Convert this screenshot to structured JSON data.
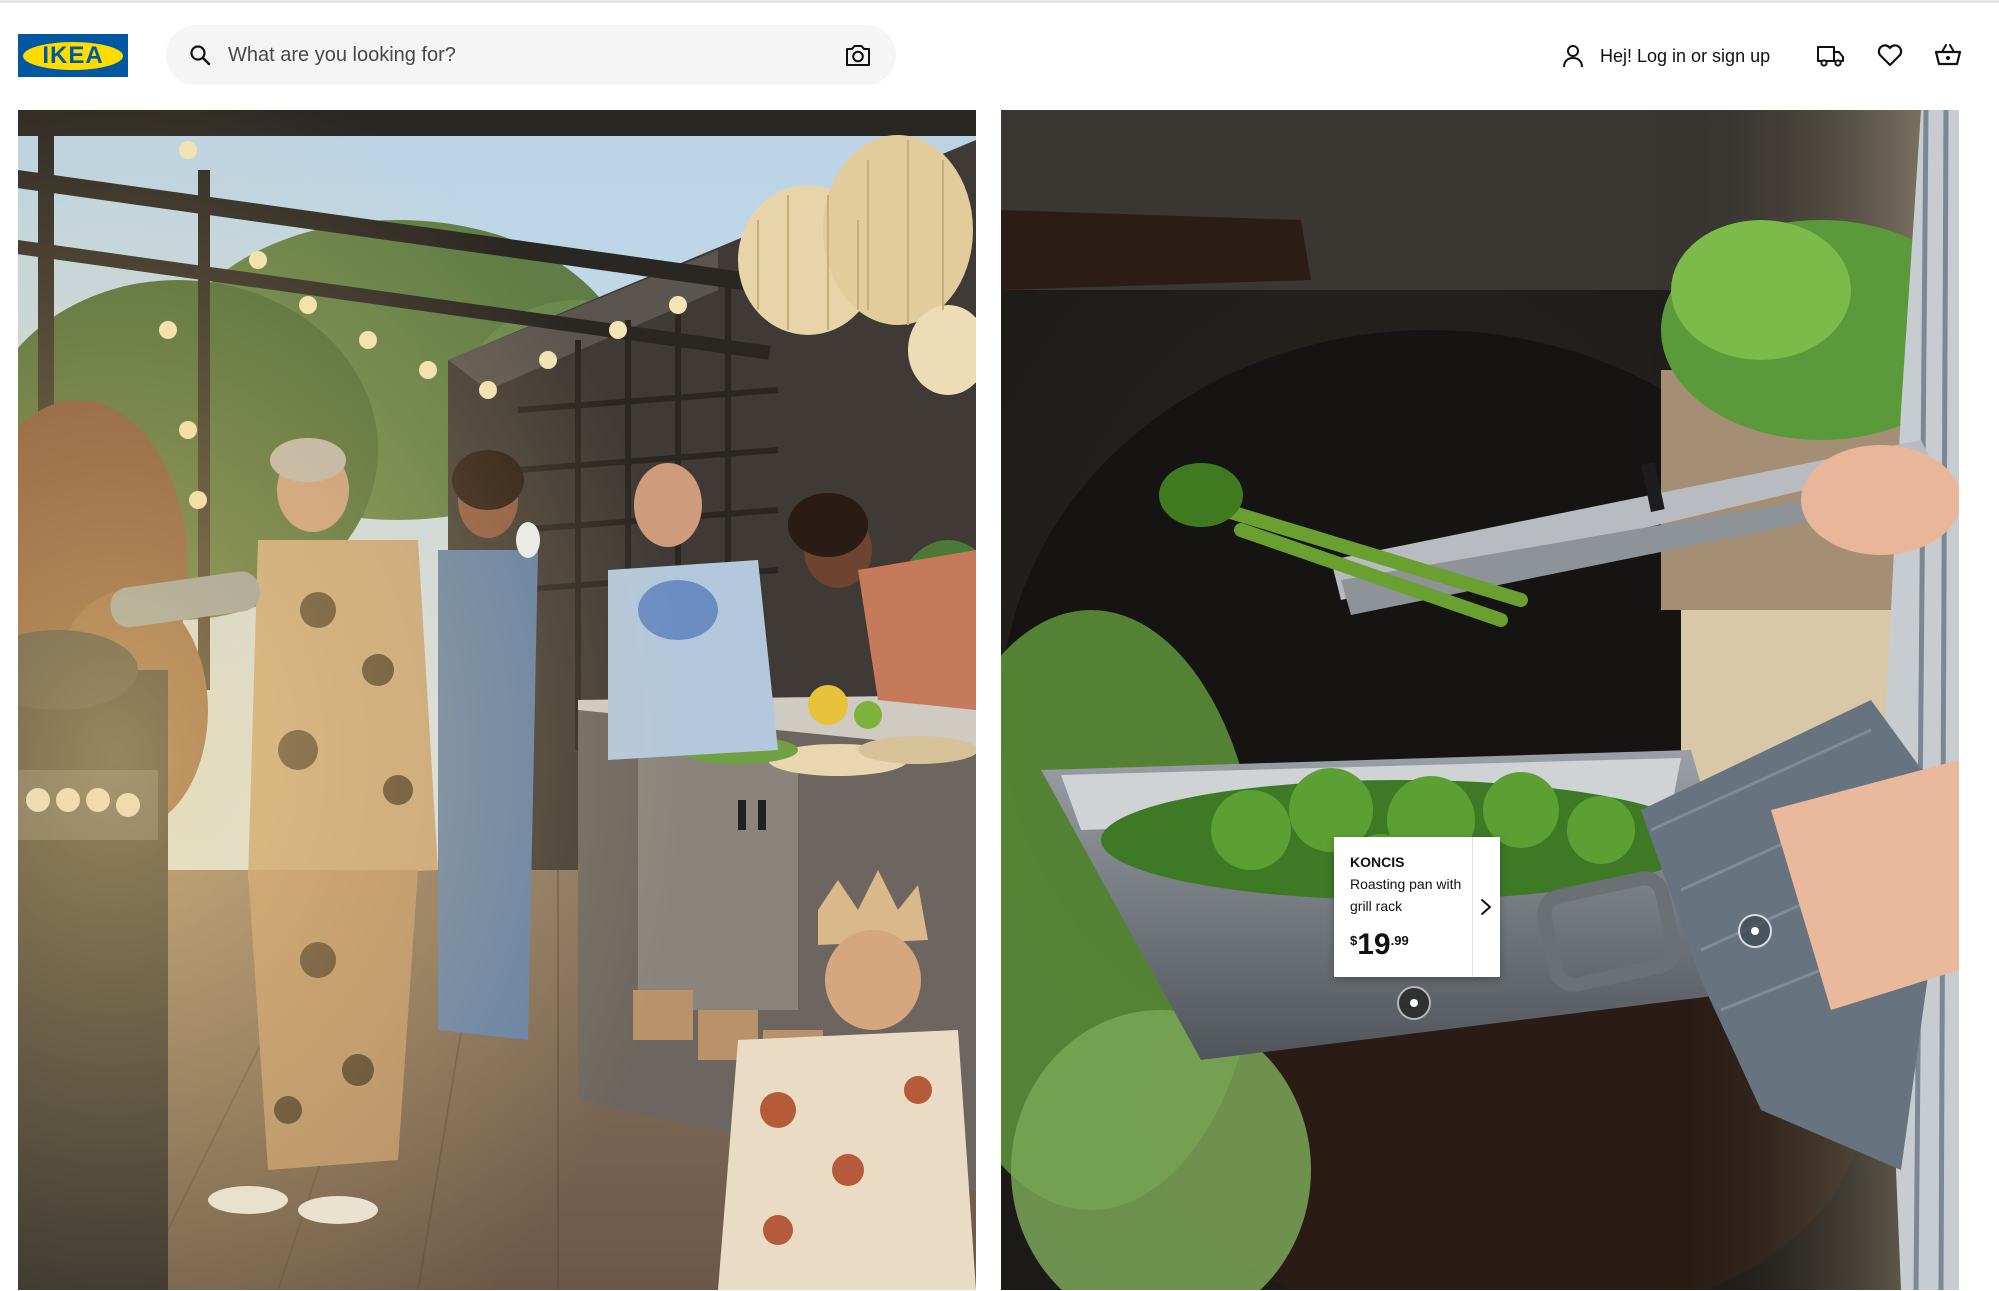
{
  "header": {
    "logo_text": "IKEA",
    "search": {
      "placeholder": "What are you looking for?",
      "value": ""
    },
    "account_label": "Hej! Log in or sign up",
    "icons": [
      "search-icon",
      "camera-icon",
      "user-icon",
      "truck-icon",
      "heart-icon",
      "basket-icon"
    ]
  },
  "hero": {
    "left_image": "outdoor-kitchen-party-photo",
    "right_image": "grilling-vegetables-roasting-pan-photo",
    "product_tag": {
      "name": "KONCIS",
      "description": "Roasting pan with grill rack",
      "price_currency": "$",
      "price_integer": "19",
      "price_decimal": ".99"
    }
  },
  "colors": {
    "brand_blue": "#0058a3",
    "brand_yellow": "#ffdb00",
    "search_bg": "#f5f5f5",
    "text": "#111111"
  }
}
